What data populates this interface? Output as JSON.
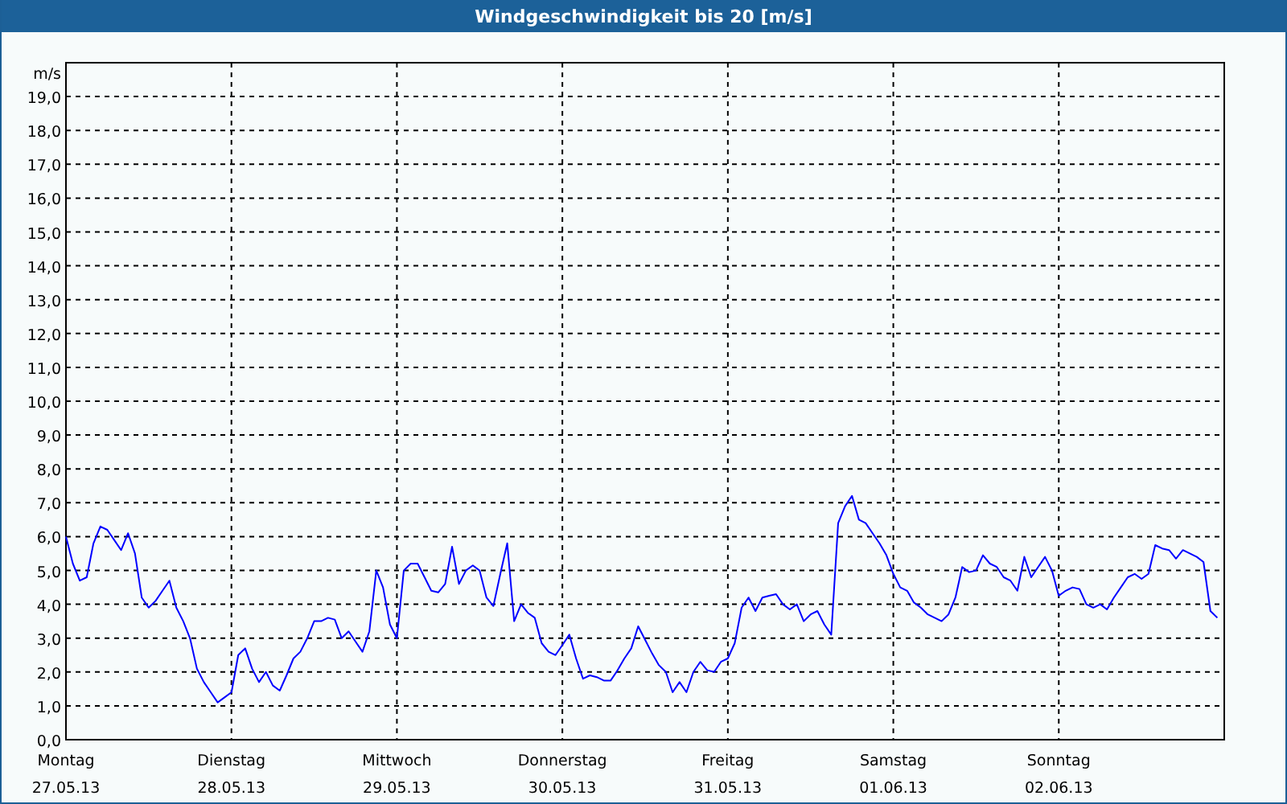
{
  "window": {
    "title": "Windgeschwindigkeit bis 20 [m/s]"
  },
  "chart": {
    "chart_data": {
      "type": "line",
      "grid": true,
      "ylabel": "m/s",
      "ylim": [
        0,
        20
      ],
      "yticks": [
        {
          "value": 0,
          "label": "0,0"
        },
        {
          "value": 1,
          "label": "1,0"
        },
        {
          "value": 2,
          "label": "2,0"
        },
        {
          "value": 3,
          "label": "3,0"
        },
        {
          "value": 4,
          "label": "4,0"
        },
        {
          "value": 5,
          "label": "5,0"
        },
        {
          "value": 6,
          "label": "6,0"
        },
        {
          "value": 7,
          "label": "7,0"
        },
        {
          "value": 8,
          "label": "8,0"
        },
        {
          "value": 9,
          "label": "9,0"
        },
        {
          "value": 10,
          "label": "10,0"
        },
        {
          "value": 11,
          "label": "11,0"
        },
        {
          "value": 12,
          "label": "12,0"
        },
        {
          "value": 13,
          "label": "13,0"
        },
        {
          "value": 14,
          "label": "14,0"
        },
        {
          "value": 15,
          "label": "15,0"
        },
        {
          "value": 16,
          "label": "16,0"
        },
        {
          "value": 17,
          "label": "17,0"
        },
        {
          "value": 18,
          "label": "18,0"
        },
        {
          "value": 19,
          "label": "19,0"
        }
      ],
      "categories": [
        "Montag",
        null,
        null,
        null,
        null,
        null,
        null,
        null,
        null,
        null,
        null,
        null,
        null,
        null,
        null,
        null,
        null,
        null,
        null,
        null,
        null,
        null,
        null,
        null,
        "Dienstag",
        null,
        null,
        null,
        null,
        null,
        null,
        null,
        null,
        null,
        null,
        null,
        null,
        null,
        null,
        null,
        null,
        null,
        null,
        null,
        null,
        null,
        null,
        null,
        "Mittwoch",
        null,
        null,
        null,
        null,
        null,
        null,
        null,
        null,
        null,
        null,
        null,
        null,
        null,
        null,
        null,
        null,
        null,
        null,
        null,
        null,
        null,
        null,
        null,
        "Donnerstag",
        null,
        null,
        null,
        null,
        null,
        null,
        null,
        null,
        null,
        null,
        null,
        null,
        null,
        null,
        null,
        null,
        null,
        null,
        null,
        null,
        null,
        null,
        null,
        "Freitag",
        null,
        null,
        null,
        null,
        null,
        null,
        null,
        null,
        null,
        null,
        null,
        null,
        null,
        null,
        null,
        null,
        null,
        null,
        null,
        null,
        null,
        null,
        null,
        "Samstag",
        null,
        null,
        null,
        null,
        null,
        null,
        null,
        null,
        null,
        null,
        null,
        null,
        null,
        null,
        null,
        null,
        null,
        null,
        null,
        null,
        null,
        null,
        null,
        "Sonntag",
        null,
        null,
        null,
        null,
        null,
        null,
        null,
        null,
        null,
        null,
        null,
        null,
        null,
        null,
        null,
        null,
        null,
        null,
        null,
        null,
        null,
        null,
        null
      ],
      "series": [
        {
          "color": "#0000ff",
          "values": [
            6.0,
            5.2,
            4.7,
            4.8,
            5.8,
            6.3,
            6.2,
            5.9,
            5.6,
            6.1,
            5.5,
            4.2,
            3.9,
            4.1,
            4.4,
            4.7,
            3.9,
            3.5,
            3.0,
            2.1,
            1.7,
            1.4,
            1.1,
            1.25,
            1.4,
            2.5,
            2.7,
            2.1,
            1.7,
            2.0,
            1.6,
            1.45,
            1.9,
            2.4,
            2.6,
            3.0,
            3.5,
            3.5,
            3.6,
            3.55,
            3.0,
            3.2,
            2.9,
            2.6,
            3.2,
            5.0,
            4.5,
            3.4,
            3.0,
            5.0,
            5.2,
            5.2,
            4.8,
            4.4,
            4.35,
            4.6,
            5.7,
            4.6,
            5.0,
            5.15,
            5.0,
            4.2,
            3.95,
            4.9,
            5.8,
            3.5,
            4.0,
            3.75,
            3.6,
            2.85,
            2.6,
            2.5,
            2.8,
            3.1,
            2.4,
            1.8,
            1.9,
            1.85,
            1.75,
            1.75,
            2.05,
            2.4,
            2.7,
            3.35,
            2.95,
            2.55,
            2.2,
            2.0,
            1.4,
            1.7,
            1.4,
            2.0,
            2.3,
            2.05,
            2.0,
            2.3,
            2.4,
            2.85,
            3.9,
            4.2,
            3.8,
            4.2,
            4.25,
            4.3,
            4.0,
            3.85,
            4.0,
            3.5,
            3.7,
            3.8,
            3.4,
            3.1,
            6.4,
            6.9,
            7.2,
            6.5,
            6.4,
            6.1,
            5.8,
            5.45,
            4.9,
            4.5,
            4.4,
            4.05,
            3.9,
            3.7,
            3.6,
            3.5,
            3.7,
            4.2,
            5.1,
            4.95,
            5.0,
            5.45,
            5.2,
            5.1,
            4.8,
            4.7,
            4.4,
            5.4,
            4.8,
            5.1,
            5.4,
            5.0,
            4.25,
            4.4,
            4.5,
            4.45,
            4.0,
            3.9,
            4.0,
            3.85,
            4.2,
            4.5,
            4.8,
            4.9,
            4.75,
            4.9,
            5.75,
            5.65,
            5.6,
            5.35,
            5.6,
            5.5,
            5.4,
            5.25,
            3.8,
            3.6
          ]
        }
      ]
    },
    "xtick_dates": [
      "27.05.13",
      "28.05.13",
      "29.05.13",
      "30.05.13",
      "31.05.13",
      "01.06.13",
      "02.06.13"
    ]
  }
}
